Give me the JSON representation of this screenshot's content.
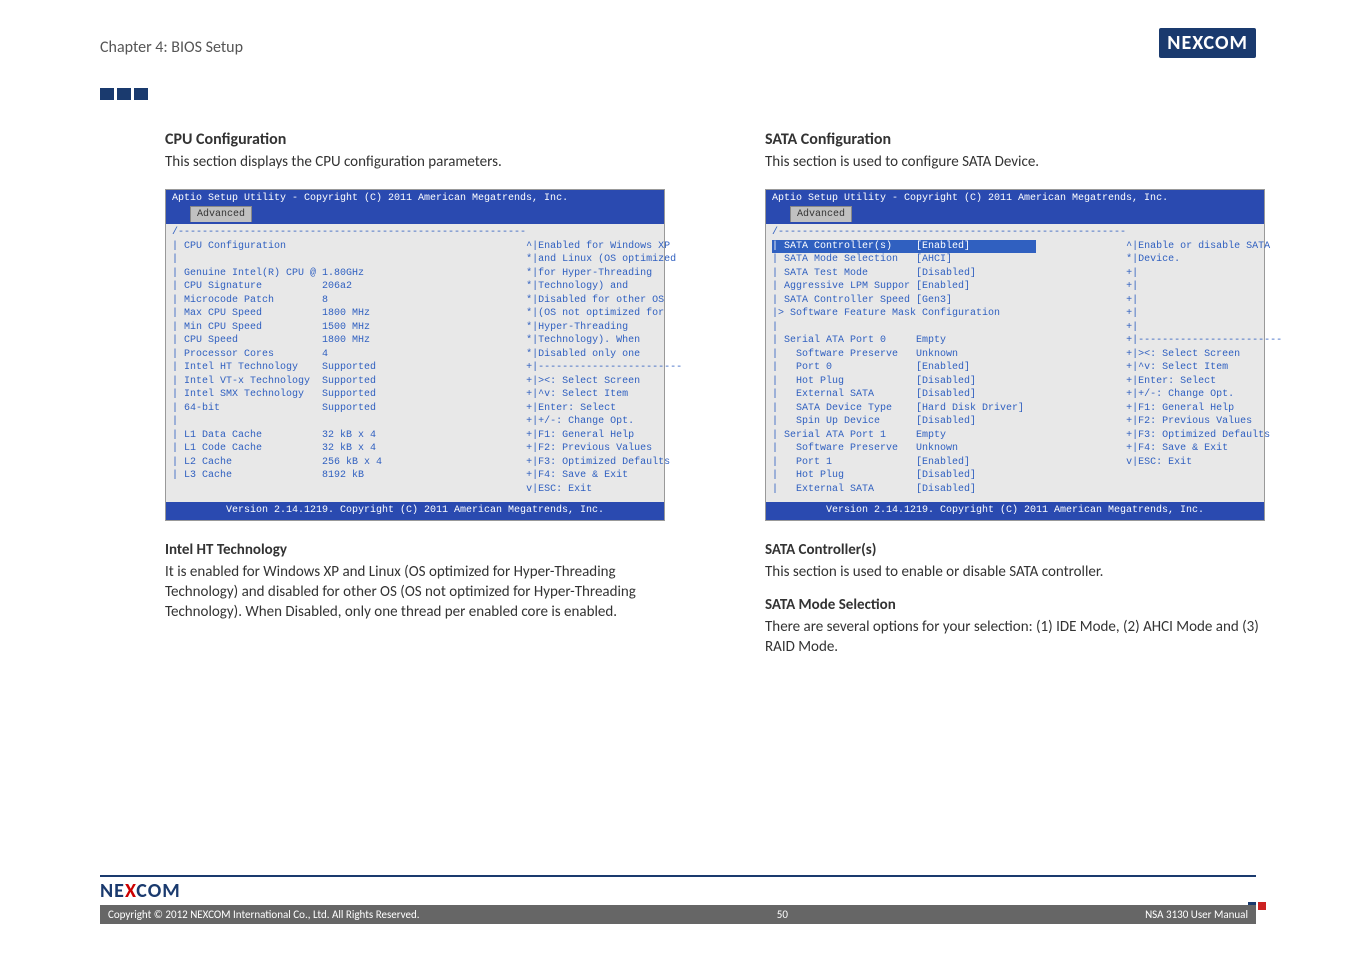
{
  "chapter": "Chapter 4: BIOS Setup",
  "brand": {
    "pre": "NE",
    "x": "X",
    "post": "COM"
  },
  "bios_common": {
    "titlebar": "Aptio Setup Utility - Copyright (C) 2011 American Megatrends, Inc.",
    "tab": "Advanced",
    "footer": "Version 2.14.1219. Copyright (C) 2011 American Megatrends, Inc.",
    "help_top": [
      "><: Select Screen",
      "^v: Select Item",
      "Enter: Select",
      "+/-: Change Opt.",
      "F1: General Help",
      "F2: Previous Values",
      "F3: Optimized Defaults",
      "F4: Save & Exit",
      "ESC: Exit"
    ]
  },
  "left": {
    "title": "CPU Configuration",
    "desc": "This section displays the CPU configuration parameters.",
    "bios_header": "CPU Configuration",
    "bios_sub": "Genuine Intel(R) CPU @ 1.80GHz",
    "bios_rows": [
      [
        "CPU Signature",
        "206a2"
      ],
      [
        "Microcode Patch",
        "8"
      ],
      [
        "Max CPU Speed",
        "1800 MHz"
      ],
      [
        "Min CPU Speed",
        "1500 MHz"
      ],
      [
        "CPU Speed",
        "1800 MHz"
      ],
      [
        "Processor Cores",
        "4"
      ],
      [
        "Intel HT Technology",
        "Supported"
      ],
      [
        "Intel VT-x Technology",
        "Supported"
      ],
      [
        "Intel SMX Technology",
        "Supported"
      ],
      [
        "64-bit",
        "Supported"
      ],
      [
        "",
        ""
      ],
      [
        "L1 Data Cache",
        "32 kB x 4"
      ],
      [
        "L1 Code Cache",
        "32 kB x 4"
      ],
      [
        "L2 Cache",
        "256 kB x 4"
      ],
      [
        "L3 Cache",
        "8192 kB"
      ]
    ],
    "bios_help": [
      "Enabled for Windows XP",
      "and Linux (OS optimized",
      "for Hyper-Threading",
      "Technology) and",
      "Disabled for other OS",
      "(OS not optimized for",
      "Hyper-Threading",
      "Technology). When",
      "Disabled only one"
    ],
    "sub1_title": "Intel HT Technology",
    "sub1_text": "It is enabled for Windows XP and Linux (OS optimized for Hyper-Threading Technology) and disabled for other OS (OS not optimized for Hyper-Threading Technology). When Disabled, only one thread per enabled core is enabled."
  },
  "right": {
    "title": "SATA Configuration",
    "desc": "This section is used to configure SATA Device.",
    "bios_rows": [
      [
        "SATA Controller(s)",
        "[Enabled]",
        true
      ],
      [
        "SATA Mode Selection",
        "[AHCI]",
        false
      ],
      [
        "SATA Test Mode",
        "[Disabled]",
        false
      ],
      [
        "Aggressive LPM Suppor",
        "[Enabled]",
        false
      ],
      [
        "SATA Controller Speed",
        "[Gen3]",
        false
      ]
    ],
    "bios_link": "> Software Feature Mask Configuration",
    "bios_ports": [
      [
        "Serial ATA Port 0",
        "Empty"
      ],
      [
        "  Software Preserve",
        "Unknown"
      ],
      [
        "  Port 0",
        "[Enabled]"
      ],
      [
        "  Hot Plug",
        "[Disabled]"
      ],
      [
        "  External SATA",
        "[Disabled]"
      ],
      [
        "  SATA Device Type",
        "[Hard Disk Driver]"
      ],
      [
        "  Spin Up Device",
        "[Disabled]"
      ],
      [
        "Serial ATA Port 1",
        "Empty"
      ],
      [
        "  Software Preserve",
        "Unknown"
      ],
      [
        "  Port 1",
        "[Enabled]"
      ],
      [
        "  Hot Plug",
        "[Disabled]"
      ],
      [
        "  External SATA",
        "[Disabled]"
      ]
    ],
    "bios_help": [
      "Enable or disable SATA",
      "Device."
    ],
    "sub1_title": "SATA Controller(s)",
    "sub1_text": "This section is used to enable or disable SATA controller.",
    "sub2_title": "SATA Mode Selection",
    "sub2_text": "There are several options for your selection: (1) IDE Mode, (2) AHCI Mode and (3) RAID Mode."
  },
  "footer": {
    "copyright": "Copyright © 2012 NEXCOM International Co., Ltd. All Rights Reserved.",
    "page": "50",
    "manual": "NSA 3130 User Manual"
  }
}
